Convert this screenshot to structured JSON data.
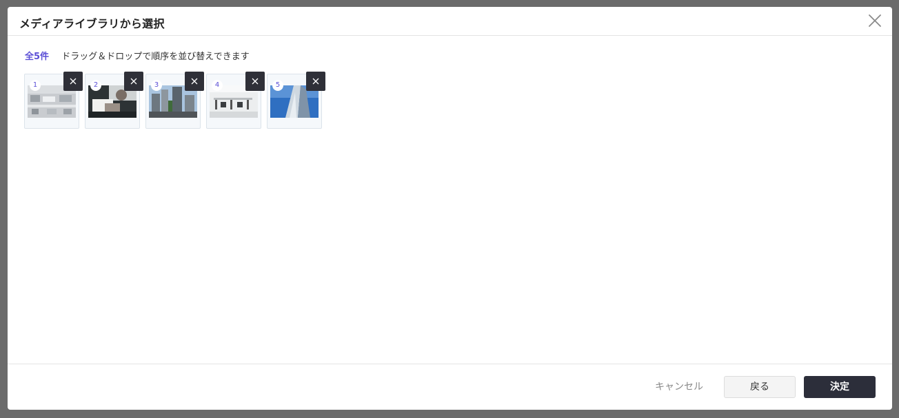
{
  "dialog": {
    "title": "メディアライブラリから選択",
    "close_icon": "close-icon"
  },
  "info": {
    "count_label": "全5件",
    "hint": "ドラッグ＆ドロップで順序を並び替えできます"
  },
  "thumbnails": [
    {
      "number": "1",
      "image": "office-interior-gray"
    },
    {
      "number": "2",
      "image": "person-working-laptop"
    },
    {
      "number": "3",
      "image": "city-buildings-street"
    },
    {
      "number": "4",
      "image": "white-office-desks"
    },
    {
      "number": "5",
      "image": "skyscraper-blue-sky"
    }
  ],
  "footer": {
    "cancel_label": "キャンセル",
    "back_label": "戻る",
    "confirm_label": "決定"
  },
  "colors": {
    "accent": "#5b4fd6",
    "dark_button": "#2c2e3a",
    "overlay": "#6b6b6b"
  }
}
